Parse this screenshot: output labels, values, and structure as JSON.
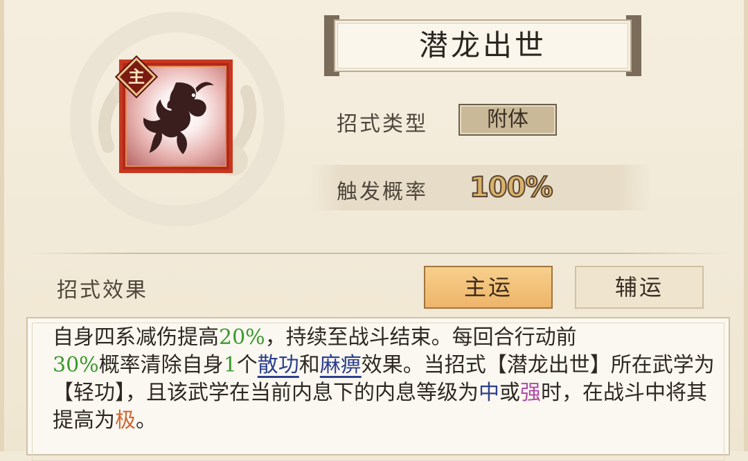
{
  "skill": {
    "name": "潜龙出世",
    "badge": "主",
    "type_label": "招式类型",
    "type_value": "附体",
    "chance_label": "触发概率",
    "chance_value": "100%"
  },
  "effect": {
    "label": "招式效果",
    "tabs": [
      {
        "label": "主运",
        "active": true
      },
      {
        "label": "辅运",
        "active": false
      }
    ],
    "description": {
      "p1": "自身四系减伤提高",
      "v1": "20%",
      "p2": "，持续至战斗结束。每回合行动前",
      "v2": "30%",
      "p3": "概率清除自身",
      "v3": "1",
      "p4": "个",
      "k1": "散功",
      "p5": "和",
      "k2": "麻痹",
      "p6": "效果。当招式【潜龙出世】所在武学为【轻功】，且该武学在当前内息下的内息等级为",
      "k3": "中",
      "p7": "或",
      "k4": "强",
      "p8": "时，在战斗中将其提高为",
      "k5": "极",
      "p9": "。"
    }
  },
  "colors": {
    "highlight_green": "#3a9a2e",
    "keyword_blue": "#2c3f8d",
    "keyword_purple": "#b04aa8",
    "keyword_orange": "#d06632",
    "active_tab": "#eeb56a"
  },
  "icons": {
    "skill_icon": "dragon-icon",
    "badge": "diamond-badge-icon"
  }
}
